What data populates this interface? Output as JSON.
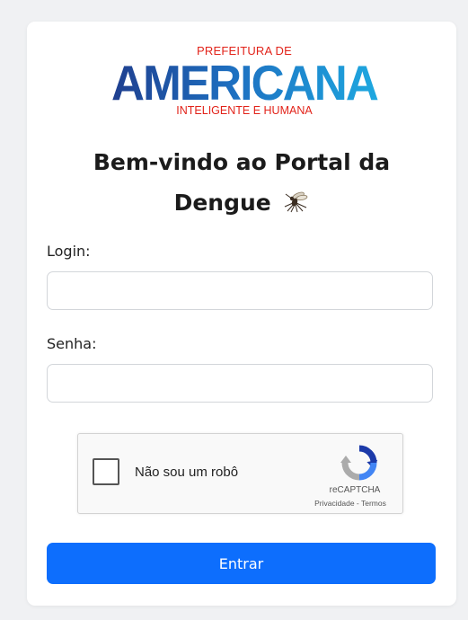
{
  "logo": {
    "line_top": "PREFEITURA DE",
    "name": "AMERICANA",
    "line_bottom": "INTELIGENTE E HUMANA",
    "colors": {
      "red": "#e2231a",
      "dark_blue": "#1f3f8f",
      "light_blue": "#1ea8e0"
    }
  },
  "header": {
    "title": "Bem-vindo ao Portal da Dengue",
    "icon": "mosquito-icon"
  },
  "form": {
    "login_label": "Login:",
    "login_value": "",
    "password_label": "Senha:",
    "password_value": ""
  },
  "recaptcha": {
    "checkbox_label": "Não sou um robô",
    "checked": false,
    "brand": "reCAPTCHA",
    "privacy": "Privacidade",
    "separator": " - ",
    "terms": "Termos"
  },
  "submit": {
    "label": "Entrar",
    "color": "#0d6efd"
  }
}
